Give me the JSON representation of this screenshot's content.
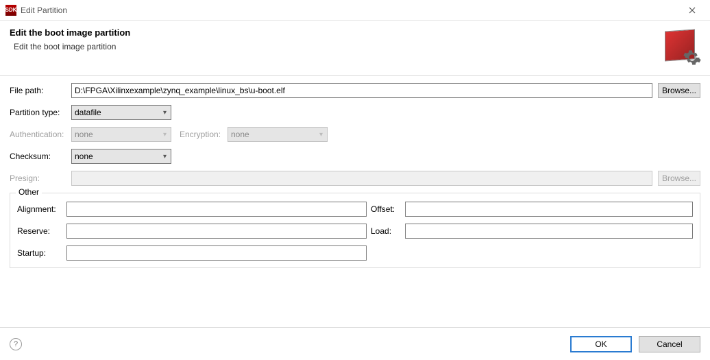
{
  "window": {
    "icon_text": "SDK",
    "title": "Edit Partition"
  },
  "header": {
    "title": "Edit the boot image partition",
    "subtitle": "Edit the boot image partition"
  },
  "form": {
    "file_path_label": "File path:",
    "file_path_value": "D:\\FPGA\\Xilinxexample\\zynq_example\\linux_bs\\u-boot.elf",
    "browse_label": "Browse...",
    "partition_type_label": "Partition type:",
    "partition_type_value": "datafile",
    "authentication_label": "Authentication:",
    "authentication_value": "none",
    "encryption_label": "Encryption:",
    "encryption_value": "none",
    "checksum_label": "Checksum:",
    "checksum_value": "none",
    "presign_label": "Presign:",
    "presign_value": "",
    "presign_browse_label": "Browse..."
  },
  "other": {
    "group_title": "Other",
    "alignment_label": "Alignment:",
    "alignment_value": "",
    "offset_label": "Offset:",
    "offset_value": "",
    "reserve_label": "Reserve:",
    "reserve_value": "",
    "load_label": "Load:",
    "load_value": "",
    "startup_label": "Startup:",
    "startup_value": ""
  },
  "footer": {
    "help_glyph": "?",
    "ok_label": "OK",
    "cancel_label": "Cancel"
  }
}
